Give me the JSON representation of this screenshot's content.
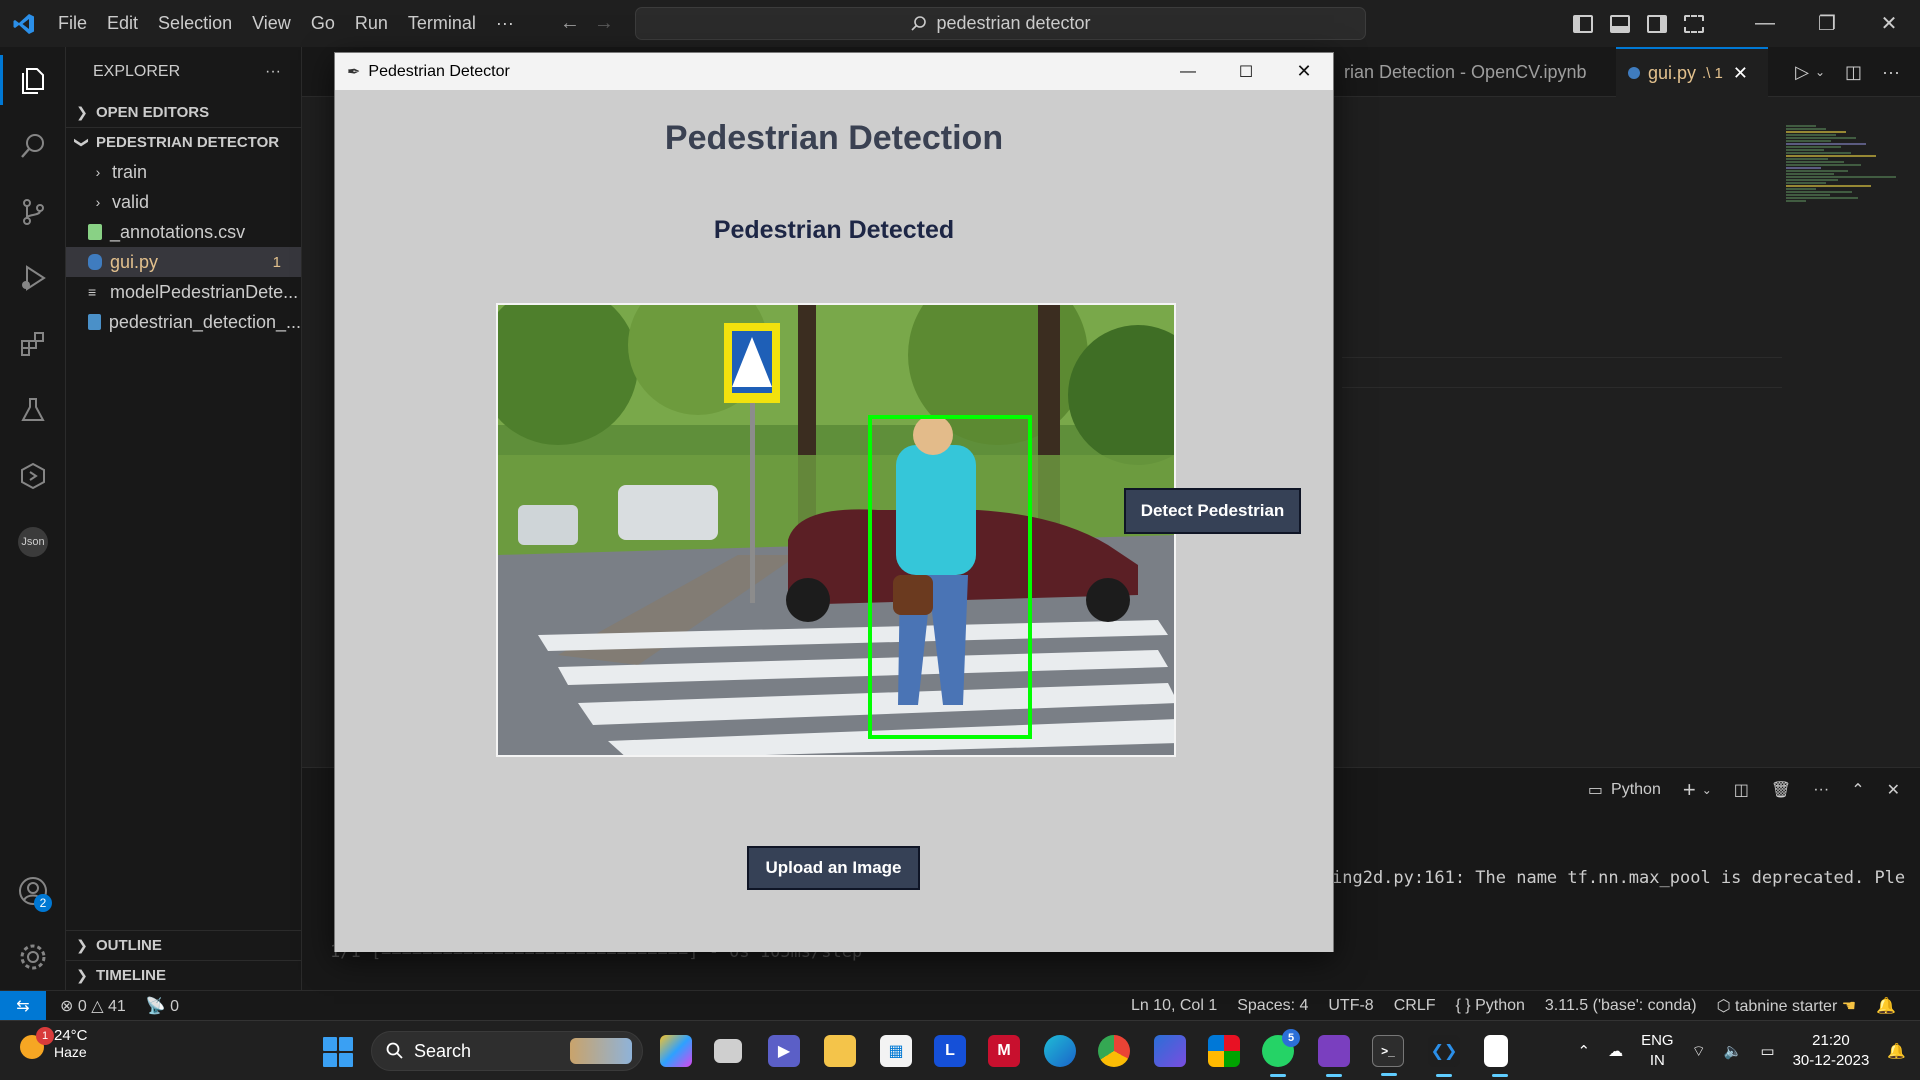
{
  "vscode": {
    "menu": [
      "File",
      "Edit",
      "Selection",
      "View",
      "Go",
      "Run",
      "Terminal",
      "···"
    ],
    "search": "pedestrian detector",
    "explorer_title": "EXPLORER",
    "explorer_more": "···",
    "sections": {
      "open_editors": "OPEN EDITORS",
      "project": "PEDESTRIAN DETECTOR",
      "outline": "OUTLINE",
      "timeline": "TIMELINE"
    },
    "tree": {
      "train": "train",
      "valid": "valid",
      "annotations": "_annotations.csv",
      "gui": "gui.py",
      "gui_badge": "1",
      "model": "modelPedestrianDete...",
      "notebook": "pedestrian_detection_..."
    },
    "account_badge": "2",
    "tabs": {
      "notebook": "rian Detection - OpenCV.ipynb",
      "gui": "gui.py",
      "gui_suffix": ".\\ 1"
    },
    "panel": {
      "shell": "Python"
    },
    "terminal": {
      "line1": "ing2d.py:161: The name tf.nn.max_pool is deprecated. Ple",
      "line2": "1/1 [==============================] - 0s 105ms/step"
    },
    "status": {
      "errors": "0",
      "warnings": "41",
      "ports": "0",
      "position": "Ln 10, Col 1",
      "spaces": "Spaces: 4",
      "encoding": "UTF-8",
      "eol": "CRLF",
      "language": "Python",
      "interpreter": "3.11.5 ('base': conda)",
      "tabnine": "tabnine starter"
    }
  },
  "app": {
    "window_title": "Pedestrian Detector",
    "heading": "Pedestrian Detection",
    "result": "Pedestrian Detected",
    "detect_button": "Detect Pedestrian",
    "upload_button": "Upload an Image"
  },
  "taskbar": {
    "weather_temp": "24°C",
    "weather_desc": "Haze",
    "weather_badge": "1",
    "search": "Search",
    "whatsapp_badge": "5",
    "lang1": "ENG",
    "lang2": "IN",
    "time": "21:20",
    "date": "30-12-2023"
  },
  "colors": {
    "vscode_accent": "#0078d4",
    "app_button": "#364156",
    "detection_box": "#00ff00"
  }
}
